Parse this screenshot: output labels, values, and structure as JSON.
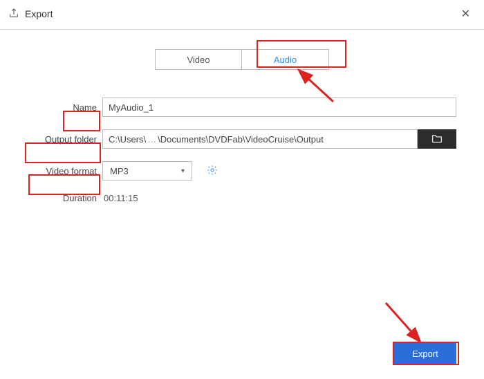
{
  "window": {
    "title": "Export"
  },
  "tabs": {
    "video": "Video",
    "audio": "Audio",
    "active": "audio"
  },
  "form": {
    "name_label": "Name",
    "name_value": "MyAudio_1",
    "folder_label": "Output folder",
    "folder_value_left": "C:\\Users\\",
    "folder_value_right": "\\Documents\\DVDFab\\VideoCruise\\Output",
    "format_label": "Video format",
    "format_value": "MP3",
    "duration_label": "Duration",
    "duration_value": "00:11:15"
  },
  "buttons": {
    "export": "Export"
  }
}
